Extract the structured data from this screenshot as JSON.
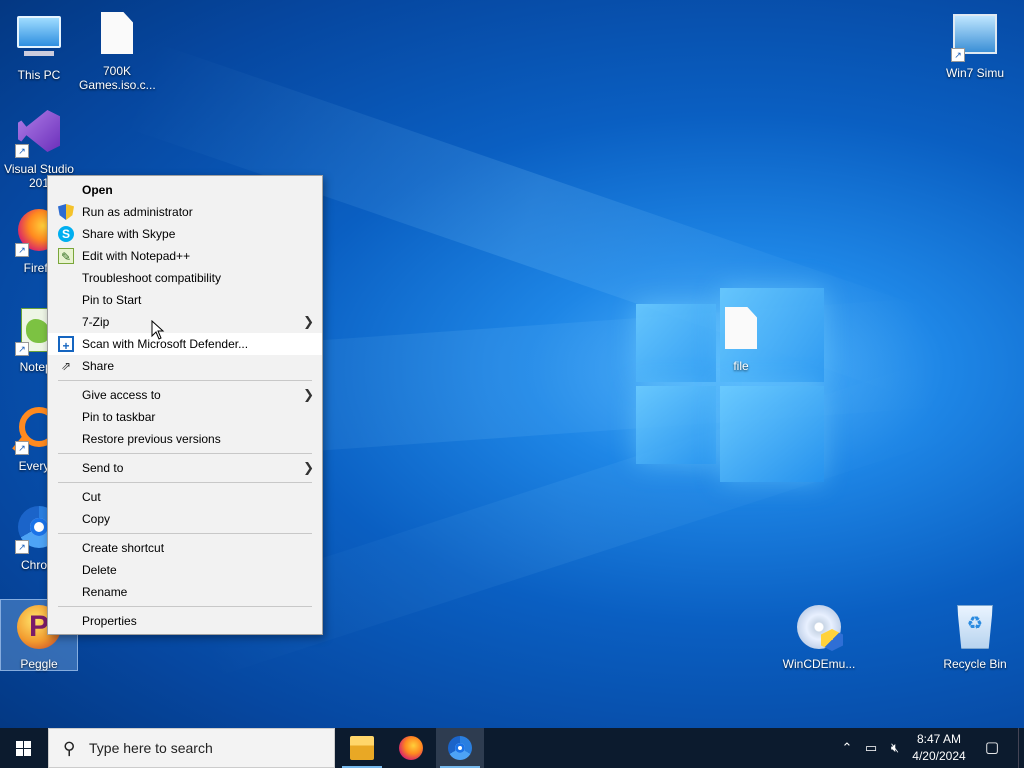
{
  "desktop": {
    "icons": [
      {
        "label": "This PC",
        "icon": "this-pc-icon"
      },
      {
        "label": "700K Games.iso.c...",
        "icon": "file-icon"
      },
      {
        "label": "Visual Studio 201",
        "icon": "visual-studio-icon"
      },
      {
        "label": "Firefo",
        "icon": "firefox-icon"
      },
      {
        "label": "Notepa",
        "icon": "notepad-plus-plus-icon"
      },
      {
        "label": "Everyth",
        "icon": "everything-search-icon"
      },
      {
        "label": "Chrom",
        "icon": "chrome-icon"
      },
      {
        "label": "Peggle",
        "icon": "peggle-icon"
      },
      {
        "label": "Win7 Simu",
        "icon": "win7-simulator-icon"
      },
      {
        "label": "file",
        "icon": "file-icon"
      },
      {
        "label": "WinCDEmu...",
        "icon": "wincdemu-icon"
      },
      {
        "label": "Recycle Bin",
        "icon": "recycle-bin-icon"
      }
    ]
  },
  "context_menu": {
    "items": [
      {
        "label": "Open"
      },
      {
        "label": "Run as administrator",
        "icon": "uac-shield-icon"
      },
      {
        "label": "Share with Skype",
        "icon": "skype-icon"
      },
      {
        "label": "Edit with Notepad++",
        "icon": "notepad-plus-plus-icon"
      },
      {
        "label": "Troubleshoot compatibility"
      },
      {
        "label": "Pin to Start"
      },
      {
        "label": "7-Zip",
        "submenu": true
      },
      {
        "label": "Scan with Microsoft Defender...",
        "icon": "defender-icon"
      },
      {
        "label": "Share",
        "icon": "share-icon"
      },
      {
        "label": "Give access to",
        "submenu": true
      },
      {
        "label": "Pin to taskbar"
      },
      {
        "label": "Restore previous versions"
      },
      {
        "label": "Send to",
        "submenu": true
      },
      {
        "label": "Cut"
      },
      {
        "label": "Copy"
      },
      {
        "label": "Create shortcut"
      },
      {
        "label": "Delete"
      },
      {
        "label": "Rename"
      },
      {
        "label": "Properties"
      }
    ],
    "hovered": "Scan with Microsoft Defender..."
  },
  "taskbar": {
    "search_placeholder": "Type here to search",
    "pinned_apps": [
      "file-explorer-icon",
      "firefox-icon",
      "chrome-icon"
    ],
    "active_app": "chrome-icon",
    "tray_icons": [
      "chevron-up-icon",
      "network-icon",
      "volume-muted-icon",
      "notification-icon"
    ],
    "clock": {
      "time": "8:47 AM",
      "date": "4/20/2024"
    }
  },
  "colors": {
    "desktop_accent": "#0a5fc2",
    "taskbar_bg": "#0c1b2e",
    "menu_bg": "#f2f2f2"
  }
}
